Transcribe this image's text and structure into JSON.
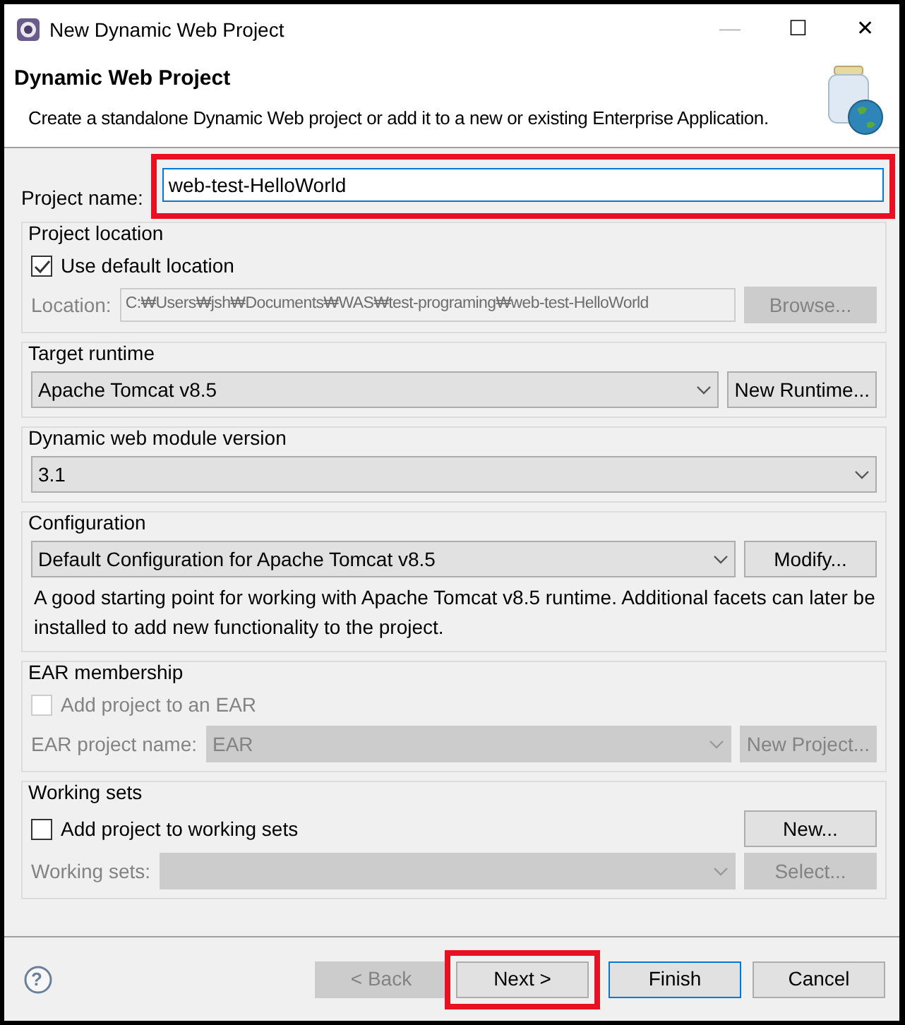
{
  "window": {
    "title": "New Dynamic Web Project",
    "controls": [
      "—",
      "☐",
      "✕"
    ]
  },
  "header": {
    "title": "Dynamic Web Project",
    "description": "Create a standalone Dynamic Web project or add it to a new or existing Enterprise Application."
  },
  "project_name": {
    "label": "Project name:",
    "value": "web-test-HelloWorld",
    "focused": true,
    "highlighted": true
  },
  "sections": [
    {
      "title": "Project location",
      "rows": [
        {
          "kind": "checkbox",
          "label": "Use default location",
          "checked": true,
          "disabled": false
        },
        {
          "kind": "field",
          "label": "Location:",
          "value": "C:₩Users₩jsh₩Documents₩WAS₩test-programing₩web-test-HelloWorld",
          "disabled": true,
          "button": {
            "label": "Browse...",
            "disabled": true
          }
        }
      ]
    },
    {
      "title": "Target runtime",
      "rows": [
        {
          "kind": "dropdown",
          "value": "Apache Tomcat v8.5",
          "disabled": false,
          "button": {
            "label": "New Runtime...",
            "disabled": false
          }
        }
      ]
    },
    {
      "title": "Dynamic web module version",
      "rows": [
        {
          "kind": "dropdown",
          "value": "3.1",
          "disabled": false
        }
      ]
    },
    {
      "title": "Configuration",
      "rows": [
        {
          "kind": "dropdown",
          "value": "Default Configuration for Apache Tomcat v8.5",
          "disabled": false,
          "button": {
            "label": "Modify...",
            "disabled": false
          }
        },
        {
          "kind": "note",
          "text": "A good starting point for working with Apache Tomcat v8.5 runtime. Additional facets can later be installed to add new functionality to the project."
        }
      ]
    },
    {
      "title": "EAR membership",
      "rows": [
        {
          "kind": "checkbox",
          "label": "Add project to an EAR",
          "checked": false,
          "disabled": true
        },
        {
          "kind": "dropdown",
          "label": "EAR project name:",
          "value": "EAR",
          "disabled": true,
          "button": {
            "label": "New Project...",
            "disabled": true
          }
        }
      ]
    },
    {
      "title": "Working sets",
      "rows": [
        {
          "kind": "checkbox",
          "label": "Add project to working sets",
          "checked": false,
          "disabled": false,
          "button": {
            "label": "New...",
            "disabled": false
          }
        },
        {
          "kind": "dropdown",
          "label": "Working sets:",
          "disabled": true,
          "button": {
            "label": "Select...",
            "disabled": true
          }
        }
      ]
    }
  ],
  "footer": {
    "help": "?",
    "buttons": [
      {
        "label": "< Back",
        "disabled": true,
        "default": false,
        "highlighted": false
      },
      {
        "label": "Next >",
        "disabled": false,
        "default": false,
        "highlighted": true
      },
      {
        "label": "Finish",
        "disabled": false,
        "default": true,
        "highlighted": false
      },
      {
        "label": "Cancel",
        "disabled": false,
        "default": false,
        "highlighted": false
      }
    ]
  }
}
